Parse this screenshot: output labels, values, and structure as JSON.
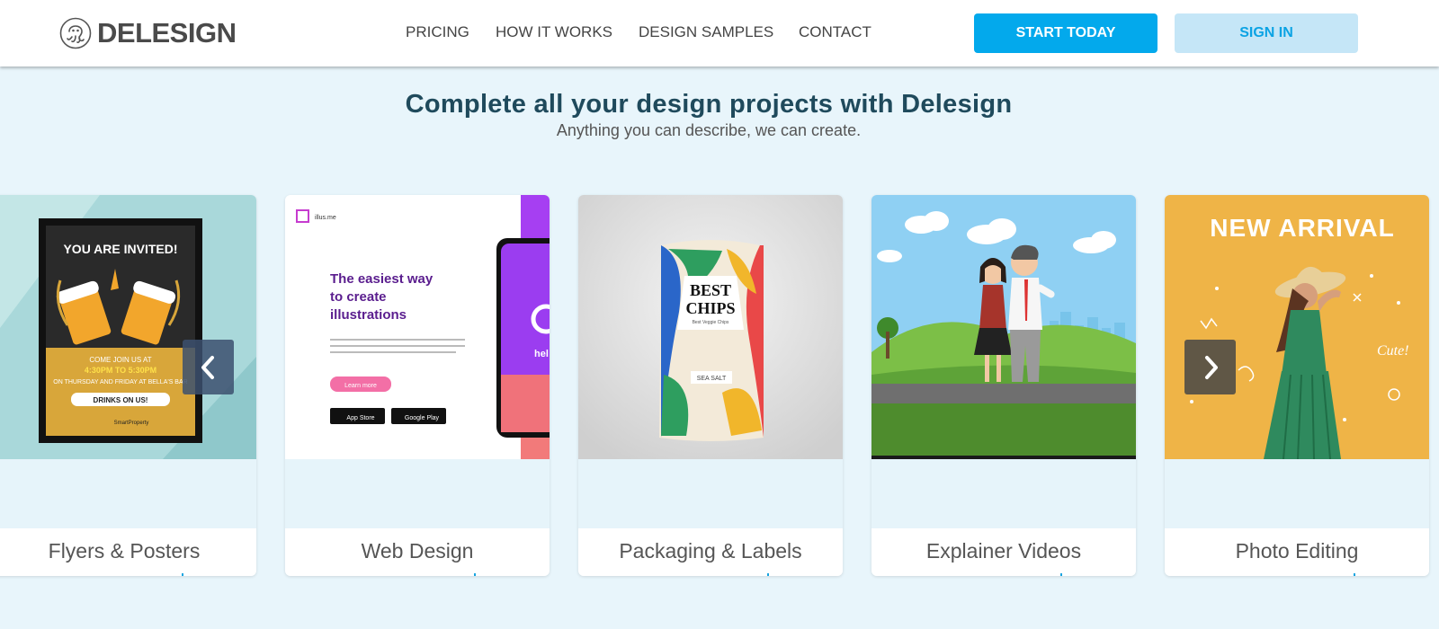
{
  "header": {
    "logo_text": "DELESIGN",
    "nav": [
      "PRICING",
      "HOW IT WORKS",
      "DESIGN SAMPLES",
      "CONTACT"
    ],
    "start_label": "START TODAY",
    "signin_label": "SIGN IN"
  },
  "hero": {
    "title": "Complete all your design projects with Delesign",
    "subtitle": "Anything you can describe, we can create."
  },
  "cards": [
    {
      "label": "Flyers & Posters",
      "image": {
        "title": "YOU ARE INVITED!",
        "line1": "COME JOIN US AT",
        "time": "4:30PM TO 5:30PM",
        "line3": "ON THURSDAY AND FRIDAY AT BELLA'S BAR",
        "pill": "DRINKS ON US!",
        "brand": "SmartProperty"
      }
    },
    {
      "label": "Web Design",
      "image": {
        "brand": "illus.me",
        "headline": [
          "The easiest way",
          "to create",
          "illustrations"
        ],
        "button": "Learn more",
        "app_store": "App Store",
        "google_play": "Google Play",
        "phone_text": "hel"
      }
    },
    {
      "label": "Packaging & Labels",
      "image": {
        "line1": "BEST",
        "line2": "CHIPS",
        "small": "Best Veggie Chips",
        "tag": "SEA SALT"
      }
    },
    {
      "label": "Explainer Videos",
      "image": {}
    },
    {
      "label": "Photo Editing",
      "image": {
        "banner": "NEW ARRIVAL",
        "doodle": "Cute!"
      }
    }
  ],
  "colors": {
    "primary": "#03a9ec",
    "secondary_button": "#c5e6f7",
    "page_bg": "#e8f5fb",
    "title": "#1f4a5c"
  },
  "icons": {
    "prev": "chevron-left-icon",
    "next": "chevron-right-icon",
    "logo": "octopus-logo-icon"
  }
}
